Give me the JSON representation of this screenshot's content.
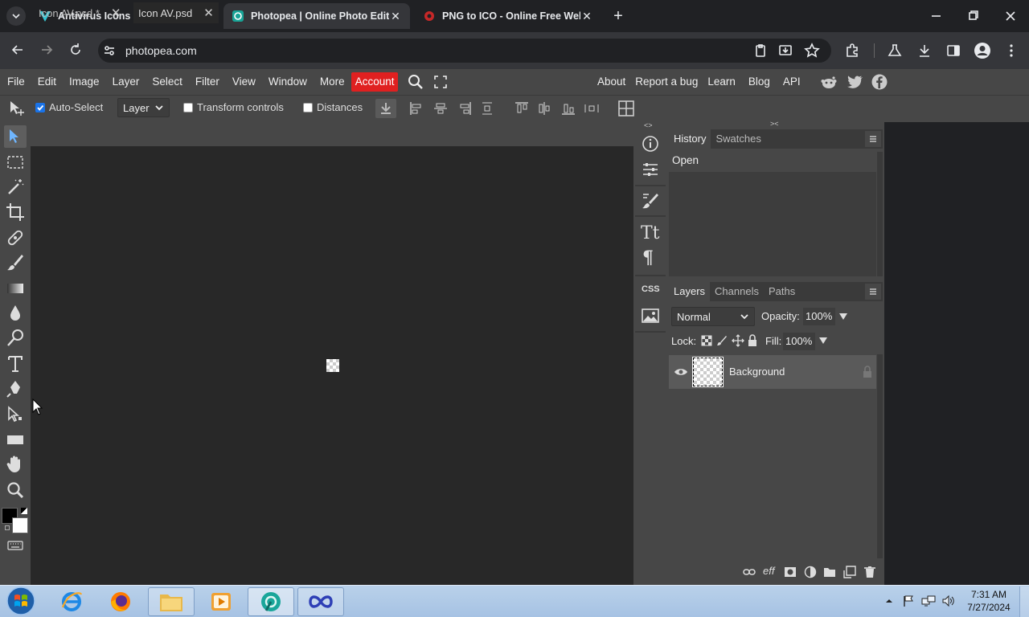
{
  "browser": {
    "tabs": [
      {
        "title": "Antivirus Icons & Symbols",
        "active": false
      },
      {
        "title": "Photopea | Online Photo Editor",
        "active": true
      },
      {
        "title": "PNG to ICO - Online Free Web",
        "active": false
      }
    ],
    "url": "photopea.com"
  },
  "menu": {
    "items": [
      "File",
      "Edit",
      "Image",
      "Layer",
      "Select",
      "Filter",
      "View",
      "Window",
      "More"
    ],
    "account": "Account",
    "right": [
      "About",
      "Report a bug",
      "Learn",
      "Blog",
      "API"
    ]
  },
  "options": {
    "auto_select": "Auto-Select",
    "auto_select_target": "Layer",
    "transform_controls": "Transform controls",
    "distances": "Distances"
  },
  "documents": [
    {
      "title": "Icon AV.psd *",
      "active": false
    },
    {
      "title": "Icon AV.psd",
      "active": true
    }
  ],
  "right_strip": {
    "css_label": "CSS"
  },
  "history_panel": {
    "tabs": [
      "History",
      "Swatches"
    ],
    "entries": [
      "Open"
    ]
  },
  "layers_panel": {
    "tabs": [
      "Layers",
      "Channels",
      "Paths"
    ],
    "blend_mode": "Normal",
    "opacity_label": "Opacity:",
    "opacity_value": "100%",
    "lock_label": "Lock:",
    "fill_label": "Fill:",
    "fill_value": "100%",
    "layers": [
      {
        "name": "Background",
        "locked": true,
        "visible": true
      }
    ]
  },
  "taskbar": {
    "time": "7:31 AM",
    "date": "7/27/2024"
  },
  "colors": {
    "account_red": "#e02020",
    "panel_gray": "#474747",
    "workspace": "#282828",
    "chrome_dark": "#202124",
    "accent_blue": "#1a73e8"
  }
}
